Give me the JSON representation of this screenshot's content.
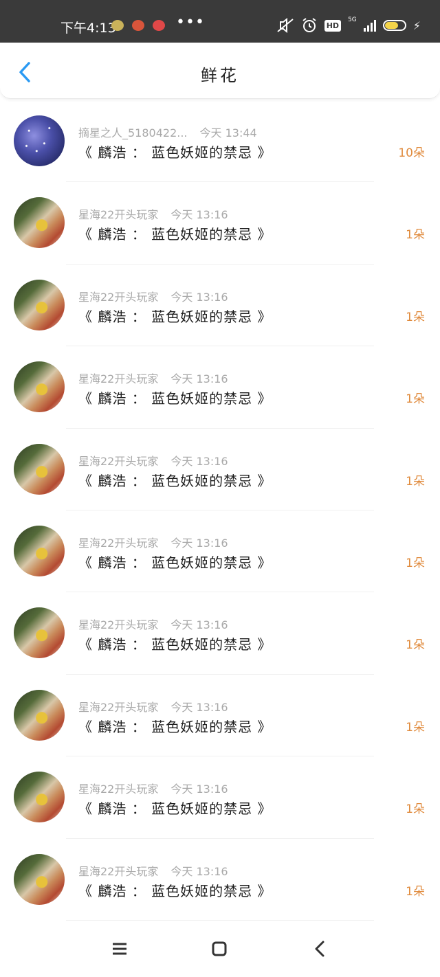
{
  "status_bar": {
    "time": "下午4:13",
    "more": "•••",
    "network": "5G",
    "hd": "HD",
    "icons": [
      "mute-icon",
      "alarm-icon",
      "hd-icon",
      "signal-icon",
      "battery-icon",
      "charging-icon"
    ]
  },
  "header": {
    "title": "鲜花",
    "back_icon": "chevron-left-icon"
  },
  "list": [
    {
      "user": "摘星之人_5180422...",
      "time": "今天 13:44",
      "title": "《 麟浩 ： 蓝色妖姬的禁忌 》",
      "count": "10朵",
      "avatar": "space"
    },
    {
      "user": "星海22开头玩家",
      "time": "今天 13:16",
      "title": "《 麟浩 ： 蓝色妖姬的禁忌 》",
      "count": "1朵",
      "avatar": "art"
    },
    {
      "user": "星海22开头玩家",
      "time": "今天 13:16",
      "title": "《 麟浩 ： 蓝色妖姬的禁忌 》",
      "count": "1朵",
      "avatar": "art"
    },
    {
      "user": "星海22开头玩家",
      "time": "今天 13:16",
      "title": "《 麟浩 ： 蓝色妖姬的禁忌 》",
      "count": "1朵",
      "avatar": "art"
    },
    {
      "user": "星海22开头玩家",
      "time": "今天 13:16",
      "title": "《 麟浩 ： 蓝色妖姬的禁忌 》",
      "count": "1朵",
      "avatar": "art"
    },
    {
      "user": "星海22开头玩家",
      "time": "今天 13:16",
      "title": "《 麟浩 ： 蓝色妖姬的禁忌 》",
      "count": "1朵",
      "avatar": "art"
    },
    {
      "user": "星海22开头玩家",
      "time": "今天 13:16",
      "title": "《 麟浩 ： 蓝色妖姬的禁忌 》",
      "count": "1朵",
      "avatar": "art"
    },
    {
      "user": "星海22开头玩家",
      "time": "今天 13:16",
      "title": "《 麟浩 ： 蓝色妖姬的禁忌 》",
      "count": "1朵",
      "avatar": "art"
    },
    {
      "user": "星海22开头玩家",
      "time": "今天 13:16",
      "title": "《 麟浩 ： 蓝色妖姬的禁忌 》",
      "count": "1朵",
      "avatar": "art"
    },
    {
      "user": "星海22开头玩家",
      "time": "今天 13:16",
      "title": "《 麟浩 ： 蓝色妖姬的禁忌 》",
      "count": "1朵",
      "avatar": "art"
    }
  ],
  "navbar": {
    "icons": [
      "menu-icon",
      "home-icon",
      "back-icon"
    ]
  },
  "colors": {
    "status_bg": "#3a3a3a",
    "accent_blue": "#2b9af3",
    "count_orange": "#e08a3c",
    "meta_gray": "#a9a9a9"
  }
}
